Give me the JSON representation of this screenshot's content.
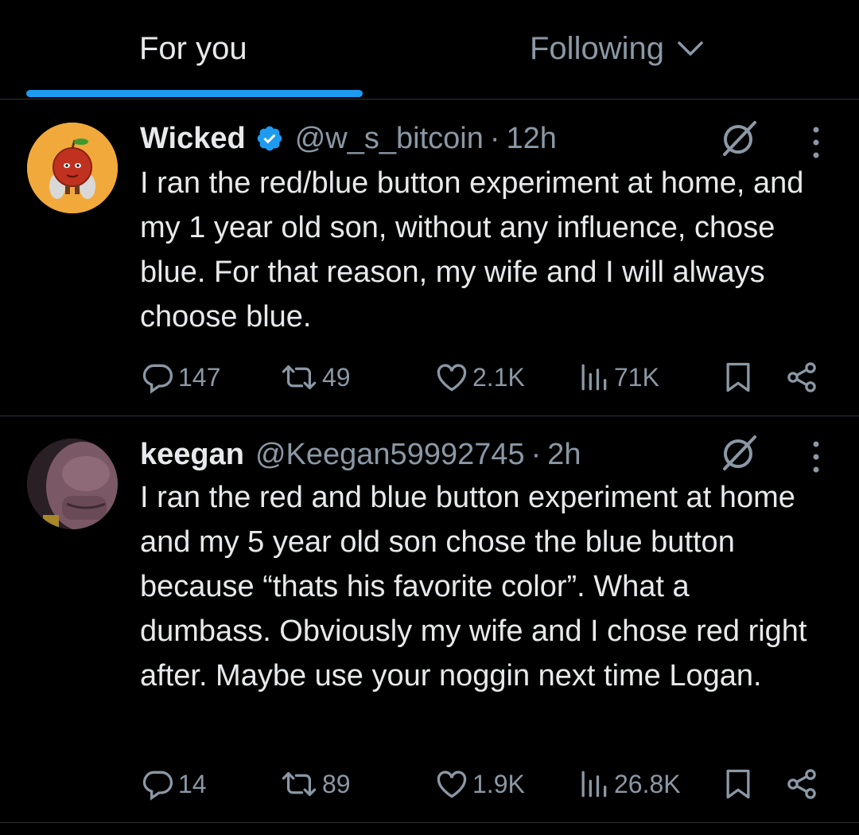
{
  "tabs": {
    "for_you": "For you",
    "following": "Following",
    "active_color": "#1d9bf0"
  },
  "tweets": [
    {
      "name": "Wicked",
      "verified": true,
      "handle": "@w_s_bitcoin",
      "separator": "·",
      "time": "12h",
      "text": "I ran the red/blue button experiment at home, and my 1 year old son, without any influence, chose blue. For that reason, my wife and I will always choose blue.",
      "replies": "147",
      "reposts": "49",
      "likes": "2.1K",
      "views": "71K"
    },
    {
      "name": "keegan",
      "verified": false,
      "handle": "@Keegan59992745",
      "separator": "·",
      "time": "2h",
      "text": "I ran the red and blue button experiment at home and my 5 year old son chose the blue button because “thats his favorite color”. What a dumbass. Obviously my wife and I chose red right after. Maybe use your noggin next time Logan.",
      "replies": "14",
      "reposts": "89",
      "likes": "1.9K",
      "views": "26.8K"
    }
  ],
  "icons": {
    "verified": "verified-badge-icon",
    "grok": "grok-icon",
    "more": "more-options-icon",
    "reply": "reply-icon",
    "repost": "repost-icon",
    "like": "heart-icon",
    "views": "views-icon",
    "bookmark": "bookmark-icon",
    "share": "share-icon"
  }
}
